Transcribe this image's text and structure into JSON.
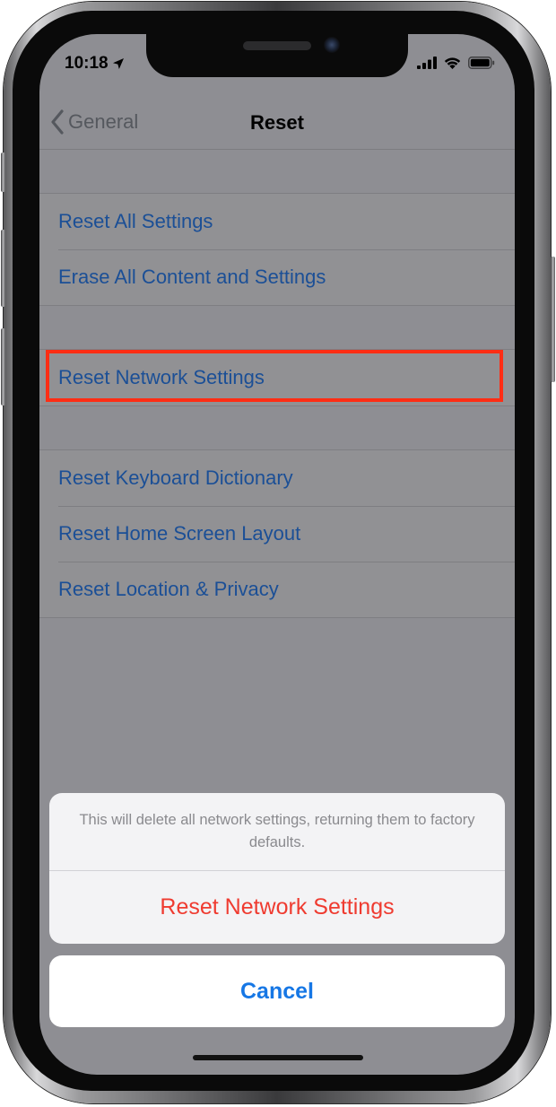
{
  "status_bar": {
    "time": "10:18"
  },
  "nav": {
    "back_label": "General",
    "title": "Reset"
  },
  "groups": [
    {
      "items": [
        "Reset All Settings",
        "Erase All Content and Settings"
      ]
    },
    {
      "items": [
        "Reset Network Settings"
      ]
    },
    {
      "items": [
        "Reset Keyboard Dictionary",
        "Reset Home Screen Layout",
        "Reset Location & Privacy"
      ]
    }
  ],
  "action_sheet": {
    "message": "This will delete all network settings, returning them to factory defaults.",
    "destructive_label": "Reset Network Settings",
    "cancel_label": "Cancel"
  },
  "colors": {
    "link_blue": "#1b4f96",
    "destructive_red": "#ef3b30",
    "cancel_blue": "#1677e5",
    "highlight_red": "#ff2d14",
    "dimmed_background": "#8e8e93"
  },
  "icons": {
    "location": "location-arrow-icon",
    "signal": "cellular-signal-icon",
    "wifi": "wifi-icon",
    "battery": "battery-icon",
    "back": "chevron-left-icon"
  }
}
